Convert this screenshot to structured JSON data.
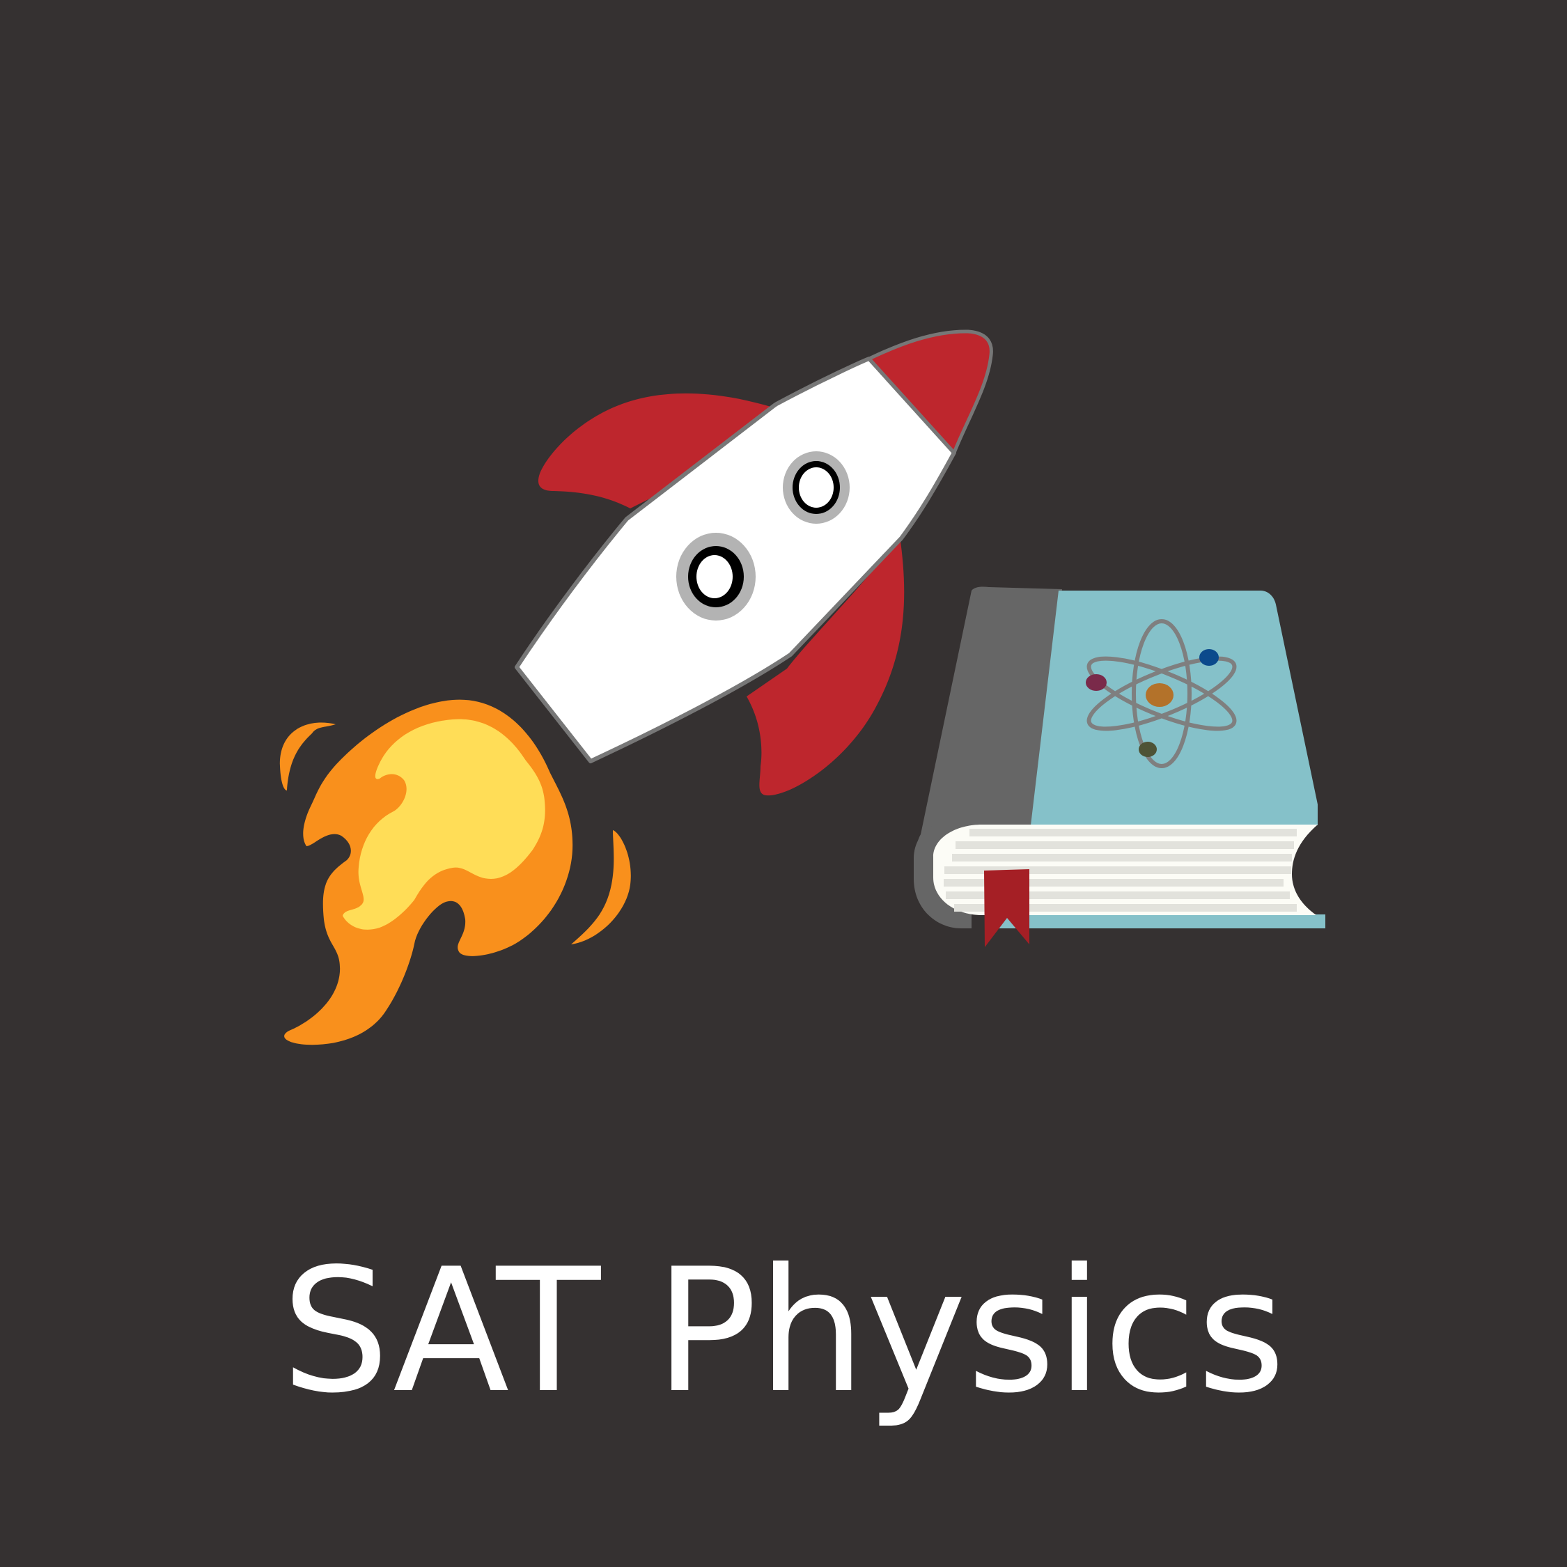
{
  "title": "SAT Physics",
  "colors": {
    "background": "#353131",
    "rocket_body": "#ffffff",
    "rocket_red": "#be262d",
    "flame_outer": "#f9901c",
    "flame_inner": "#ffdd57",
    "book_cover": "#85c1c9",
    "book_spine": "#666666",
    "pages": "#fcfcf6",
    "bookmark": "#a51f25",
    "text": "#ffffff"
  },
  "icons": [
    "rocket-icon",
    "flame-icon",
    "physics-book-icon",
    "atom-icon",
    "bookmark-icon"
  ]
}
